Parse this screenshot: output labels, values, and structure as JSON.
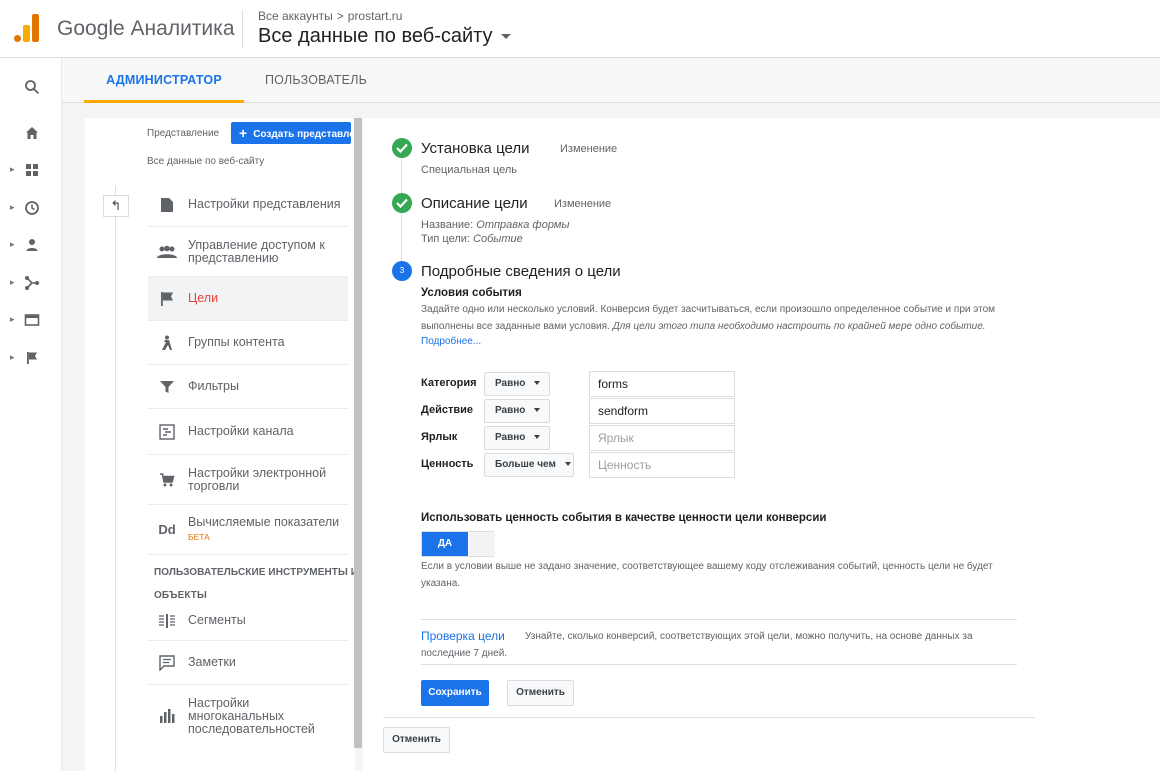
{
  "header": {
    "brand": "Google Аналитика",
    "breadcrumb": [
      "Все аккаунты",
      "prostart.ru"
    ],
    "breadcrumb_sep": ">",
    "view_title": "Все данные по веб-сайту"
  },
  "rail": {
    "items": [
      "search-icon",
      "home-icon",
      "dashboard-icon",
      "clock-icon",
      "person-icon",
      "acquisition-icon",
      "behavior-icon",
      "flag-icon"
    ]
  },
  "tabs": [
    {
      "label": "АДМИНИСТРАТОР",
      "active": true
    },
    {
      "label": "ПОЛЬЗОВАТЕЛЬ",
      "active": false
    }
  ],
  "admin": {
    "view_label": "Представление",
    "create_button": "Создать представление",
    "view_name": "Все данные по веб-сайту",
    "items": [
      {
        "label": "Настройки представления",
        "icon": "document-icon"
      },
      {
        "label": "Управление доступом к представлению",
        "icon": "people-icon"
      },
      {
        "label": "Цели",
        "icon": "flag-icon",
        "active": true
      },
      {
        "label": "Группы контента",
        "icon": "figure-icon"
      },
      {
        "label": "Фильтры",
        "icon": "filter-icon"
      },
      {
        "label": "Настройки канала",
        "icon": "channel-icon"
      },
      {
        "label": "Настройки электронной торговли",
        "icon": "cart-icon"
      },
      {
        "label": "Вычисляемые показатели",
        "badge": "БЕТА",
        "icon": "dd-icon"
      }
    ],
    "section_header_1": "ПОЛЬЗОВАТЕЛЬСКИЕ ИНСТРУМЕНТЫ И",
    "section_header_2": "ОБЪЕКТЫ",
    "tools": [
      {
        "label": "Сегменты",
        "icon": "segments-icon"
      },
      {
        "label": "Заметки",
        "icon": "notes-icon"
      },
      {
        "label": "Настройки многоканальных последовательностей",
        "icon": "bars-icon"
      }
    ]
  },
  "goal": {
    "step1": {
      "title": "Установка цели",
      "edit": "Изменение",
      "sub": "Специальная цель"
    },
    "step2": {
      "title": "Описание цели",
      "edit": "Изменение",
      "name_label": "Название:",
      "name_value": "Отправка формы",
      "type_label": "Тип цели:",
      "type_value": "Событие"
    },
    "step3": {
      "num": "3",
      "title": "Подробные сведения о цели"
    },
    "conditions_title": "Условия события",
    "conditions_desc": "Задайте одно или несколько условий. Конверсия будет засчитываться, если произошло определенное событие и при этом выполнены все заданные вами условия.",
    "conditions_desc_italic": "Для цели этого типа необходимо настроить по крайней мере одно событие.",
    "more_link": "Подробнее...",
    "conditions": [
      {
        "label": "Категория",
        "op": "Равно",
        "value": "forms",
        "placeholder": false
      },
      {
        "label": "Действие",
        "op": "Равно",
        "value": "sendform",
        "placeholder": false
      },
      {
        "label": "Ярлык",
        "op": "Равно",
        "value": "Ярлык",
        "placeholder": true
      },
      {
        "label": "Ценность",
        "op": "Больше чем",
        "value": "Ценность",
        "placeholder": true
      }
    ],
    "use_value_title": "Использовать ценность события в качестве ценности цели конверсии",
    "toggle_label": "ДА",
    "use_value_note": "Если в условии выше не задано значение, соответствующее вашему коду отслеживания событий, ценность цели не будет указана.",
    "verify_link": "Проверка цели",
    "verify_text": "Узнайте, сколько конверсий, соответствующих этой цели, можно получить, на основе данных за последние 7 дней.",
    "save_button": "Сохранить",
    "cancel_button": "Отменить",
    "outer_cancel_button": "Отменить"
  },
  "colors": {
    "accent": "#1a73e8",
    "tab_underline": "#f9ab00",
    "success": "#34a853",
    "active_item": "#e8453c"
  }
}
